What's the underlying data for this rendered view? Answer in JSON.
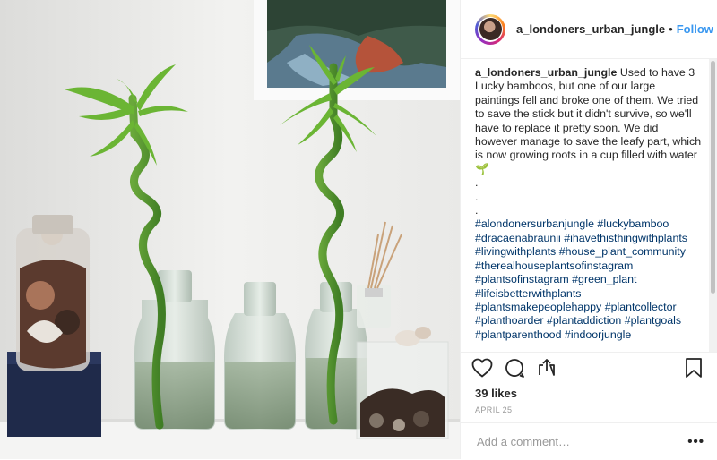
{
  "post": {
    "username": "a_londoners_urban_jungle",
    "dot": "•",
    "follow_label": "Follow",
    "caption_text": "Used to have 3 Lucky bamboos, but one of our large paintings fell and broke one of them. We tried to save the stick but it didn't survive, so we'll have to replace it pretty soon. We did however manage to save the leafy part, which is now growing roots in a cup filled with water 🌱",
    "caption_dots": [
      ".",
      ".",
      "."
    ],
    "hashtags": [
      "#alondonersurbanjungle",
      "#luckybamboo",
      "#dracaenabraunii",
      "#ihavethisthingwithplants",
      "#livingwithplants",
      "#house_plant_community",
      "#therealhouseplantsofinstagram",
      "#plantsofinstagram",
      "#green_plant",
      "#lifeisbetterwithplants",
      "#plantsmakepeoplehappy",
      "#plantcollector",
      "#planthoarder",
      "#plantaddiction",
      "#plantgoals",
      "#plantparenthood",
      "#indoorjungle"
    ],
    "likes": "39 likes",
    "date": "APRIL 25",
    "comment_placeholder": "Add a comment…",
    "more": "•••"
  },
  "icons": [
    "heart-icon",
    "comment-icon",
    "share-icon",
    "bookmark-icon"
  ],
  "colors": {
    "link": "#003569",
    "follow": "#3897f0",
    "muted": "#999999",
    "border": "#efefef"
  }
}
